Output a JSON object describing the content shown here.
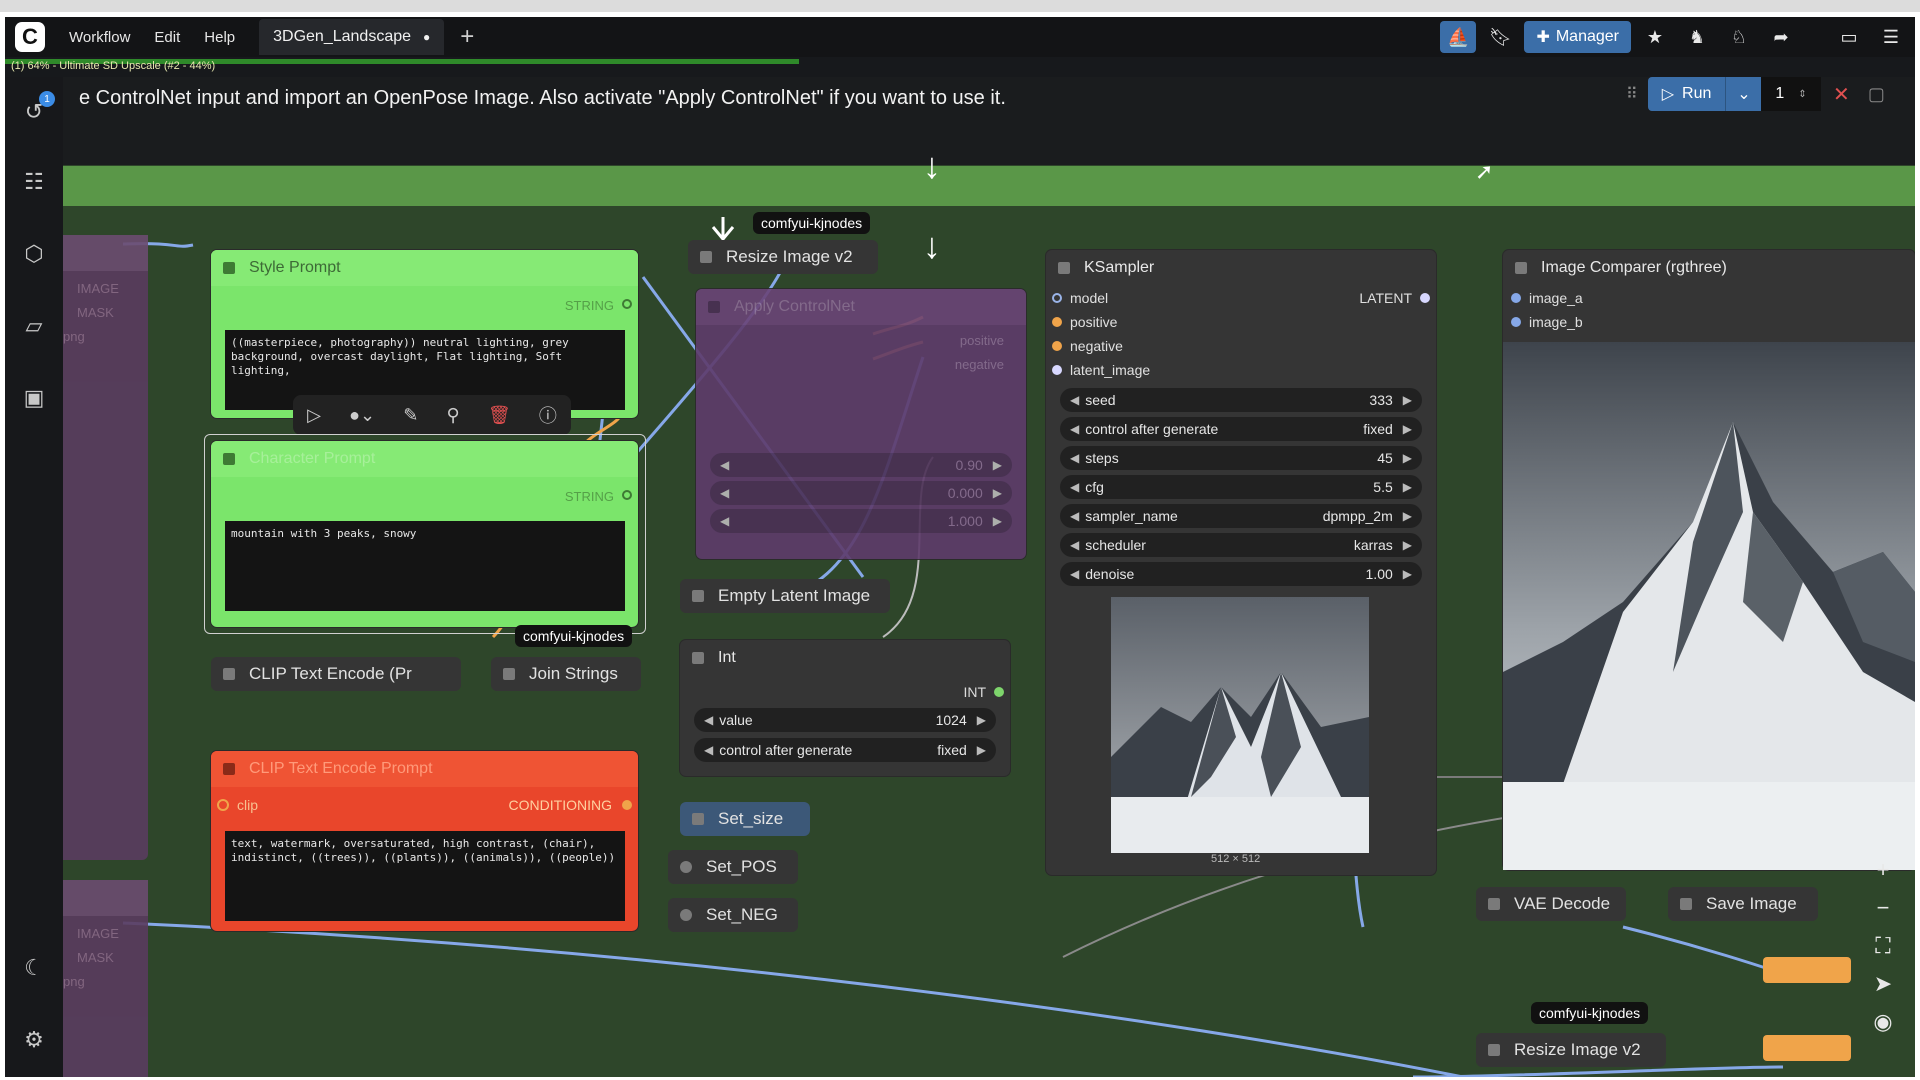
{
  "menu": {
    "items": [
      "Workflow",
      "Edit",
      "Help"
    ],
    "workflow_tab": "3DGen_Landscape",
    "tab_modified_dot": "●",
    "add_tab": "+",
    "manager": "Manager",
    "run": "Run",
    "queue_count": "1"
  },
  "progress": {
    "label": "(1) 64% - Ultimate SD Upscale (#2 - 44%)",
    "percent": 64
  },
  "message": "e ControlNet input and import an OpenPose Image. Also activate \"Apply ControlNet\" if you want to use it.",
  "history_badge": "1",
  "tags": {
    "kjnodes": "comfyui-kjnodes"
  },
  "style_prompt": {
    "title": "Style Prompt",
    "output": "STRING",
    "text": "((masterpiece, photography)) neutral lighting, grey background, overcast daylight, Flat lighting, Soft lighting,"
  },
  "character_prompt": {
    "title": "Character Prompt",
    "output": "STRING",
    "text": "mountain with 3 peaks, snowy"
  },
  "neg_prompt": {
    "title": "CLIP Text Encode Prompt",
    "input": "clip",
    "output": "CONDITIONING",
    "text": "text, watermark, oversaturated, high contrast, (chair), indistinct, ((trees)), ((plants)), ((animals)), ((people))"
  },
  "apply_controlnet": {
    "title": "Apply ControlNet",
    "out_positive": "positive",
    "out_negative": "negative",
    "strength": "0.90",
    "start_percent": "0.000",
    "end_percent": "1.000"
  },
  "small_nodes": {
    "resize_top": "Resize Image v2",
    "resize_bottom": "Resize Image v2",
    "empty_latent": "Empty Latent Image",
    "clip_encode": "CLIP Text Encode (Pr",
    "join_strings": "Join Strings",
    "set_size": "Set_size",
    "set_pos": "Set_POS",
    "set_neg": "Set_NEG",
    "vae_decode": "VAE Decode",
    "save_image": "Save Image"
  },
  "int_node": {
    "title": "Int",
    "output": "INT",
    "value_label": "value",
    "value": "1024",
    "cag_label": "control after generate",
    "cag_value": "fixed"
  },
  "ksampler": {
    "title": "KSampler",
    "inputs": [
      "model",
      "positive",
      "negative",
      "latent_image"
    ],
    "output": "LATENT",
    "widgets": [
      {
        "label": "seed",
        "value": "333"
      },
      {
        "label": "control after generate",
        "value": "fixed"
      },
      {
        "label": "steps",
        "value": "45"
      },
      {
        "label": "cfg",
        "value": "5.5"
      },
      {
        "label": "sampler_name",
        "value": "dpmpp_2m"
      },
      {
        "label": "scheduler",
        "value": "karras"
      },
      {
        "label": "denoise",
        "value": "1.00"
      }
    ],
    "preview_size": "512 × 512"
  },
  "comparer": {
    "title": "Image Comparer (rgthree)",
    "inputs": [
      "image_a",
      "image_b"
    ]
  },
  "left_faded": {
    "image": "IMAGE",
    "mask": "MASK",
    "png": "png"
  },
  "colors": {
    "canvas_green": "#2e462a",
    "band_green": "#5a9748",
    "prompt_green": "#7be56b",
    "negative_red": "#e9462b",
    "controlnet_purple": "#5e3b6b",
    "accent_blue": "#3b6ea8",
    "wire_blue": "#86a8e8",
    "wire_orange": "#f0a44a"
  }
}
